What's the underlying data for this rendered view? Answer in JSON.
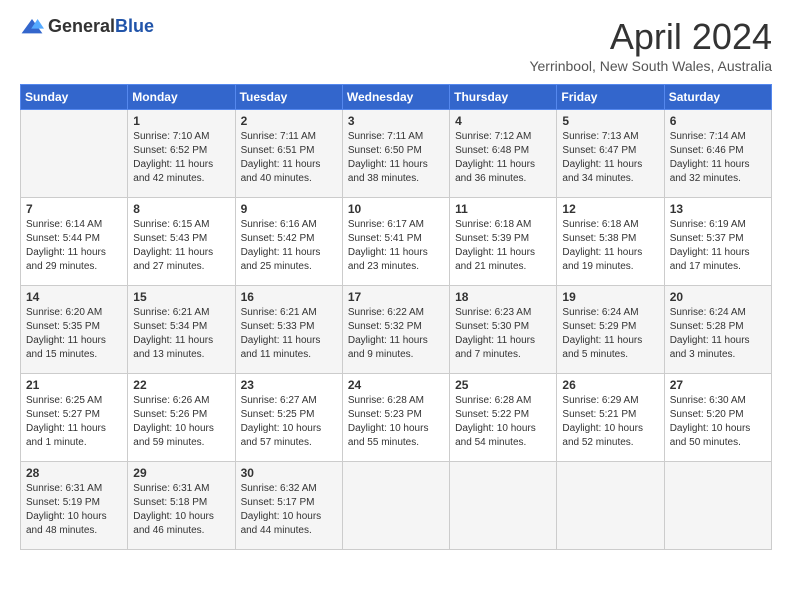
{
  "header": {
    "logo_general": "General",
    "logo_blue": "Blue",
    "month_title": "April 2024",
    "location": "Yerrinbool, New South Wales, Australia"
  },
  "days_of_week": [
    "Sunday",
    "Monday",
    "Tuesday",
    "Wednesday",
    "Thursday",
    "Friday",
    "Saturday"
  ],
  "weeks": [
    [
      {
        "day": "",
        "lines": []
      },
      {
        "day": "1",
        "lines": [
          "Sunrise: 7:10 AM",
          "Sunset: 6:52 PM",
          "Daylight: 11 hours",
          "and 42 minutes."
        ]
      },
      {
        "day": "2",
        "lines": [
          "Sunrise: 7:11 AM",
          "Sunset: 6:51 PM",
          "Daylight: 11 hours",
          "and 40 minutes."
        ]
      },
      {
        "day": "3",
        "lines": [
          "Sunrise: 7:11 AM",
          "Sunset: 6:50 PM",
          "Daylight: 11 hours",
          "and 38 minutes."
        ]
      },
      {
        "day": "4",
        "lines": [
          "Sunrise: 7:12 AM",
          "Sunset: 6:48 PM",
          "Daylight: 11 hours",
          "and 36 minutes."
        ]
      },
      {
        "day": "5",
        "lines": [
          "Sunrise: 7:13 AM",
          "Sunset: 6:47 PM",
          "Daylight: 11 hours",
          "and 34 minutes."
        ]
      },
      {
        "day": "6",
        "lines": [
          "Sunrise: 7:14 AM",
          "Sunset: 6:46 PM",
          "Daylight: 11 hours",
          "and 32 minutes."
        ]
      }
    ],
    [
      {
        "day": "7",
        "lines": [
          "Sunrise: 6:14 AM",
          "Sunset: 5:44 PM",
          "Daylight: 11 hours",
          "and 29 minutes."
        ]
      },
      {
        "day": "8",
        "lines": [
          "Sunrise: 6:15 AM",
          "Sunset: 5:43 PM",
          "Daylight: 11 hours",
          "and 27 minutes."
        ]
      },
      {
        "day": "9",
        "lines": [
          "Sunrise: 6:16 AM",
          "Sunset: 5:42 PM",
          "Daylight: 11 hours",
          "and 25 minutes."
        ]
      },
      {
        "day": "10",
        "lines": [
          "Sunrise: 6:17 AM",
          "Sunset: 5:41 PM",
          "Daylight: 11 hours",
          "and 23 minutes."
        ]
      },
      {
        "day": "11",
        "lines": [
          "Sunrise: 6:18 AM",
          "Sunset: 5:39 PM",
          "Daylight: 11 hours",
          "and 21 minutes."
        ]
      },
      {
        "day": "12",
        "lines": [
          "Sunrise: 6:18 AM",
          "Sunset: 5:38 PM",
          "Daylight: 11 hours",
          "and 19 minutes."
        ]
      },
      {
        "day": "13",
        "lines": [
          "Sunrise: 6:19 AM",
          "Sunset: 5:37 PM",
          "Daylight: 11 hours",
          "and 17 minutes."
        ]
      }
    ],
    [
      {
        "day": "14",
        "lines": [
          "Sunrise: 6:20 AM",
          "Sunset: 5:35 PM",
          "Daylight: 11 hours",
          "and 15 minutes."
        ]
      },
      {
        "day": "15",
        "lines": [
          "Sunrise: 6:21 AM",
          "Sunset: 5:34 PM",
          "Daylight: 11 hours",
          "and 13 minutes."
        ]
      },
      {
        "day": "16",
        "lines": [
          "Sunrise: 6:21 AM",
          "Sunset: 5:33 PM",
          "Daylight: 11 hours",
          "and 11 minutes."
        ]
      },
      {
        "day": "17",
        "lines": [
          "Sunrise: 6:22 AM",
          "Sunset: 5:32 PM",
          "Daylight: 11 hours",
          "and 9 minutes."
        ]
      },
      {
        "day": "18",
        "lines": [
          "Sunrise: 6:23 AM",
          "Sunset: 5:30 PM",
          "Daylight: 11 hours",
          "and 7 minutes."
        ]
      },
      {
        "day": "19",
        "lines": [
          "Sunrise: 6:24 AM",
          "Sunset: 5:29 PM",
          "Daylight: 11 hours",
          "and 5 minutes."
        ]
      },
      {
        "day": "20",
        "lines": [
          "Sunrise: 6:24 AM",
          "Sunset: 5:28 PM",
          "Daylight: 11 hours",
          "and 3 minutes."
        ]
      }
    ],
    [
      {
        "day": "21",
        "lines": [
          "Sunrise: 6:25 AM",
          "Sunset: 5:27 PM",
          "Daylight: 11 hours",
          "and 1 minute."
        ]
      },
      {
        "day": "22",
        "lines": [
          "Sunrise: 6:26 AM",
          "Sunset: 5:26 PM",
          "Daylight: 10 hours",
          "and 59 minutes."
        ]
      },
      {
        "day": "23",
        "lines": [
          "Sunrise: 6:27 AM",
          "Sunset: 5:25 PM",
          "Daylight: 10 hours",
          "and 57 minutes."
        ]
      },
      {
        "day": "24",
        "lines": [
          "Sunrise: 6:28 AM",
          "Sunset: 5:23 PM",
          "Daylight: 10 hours",
          "and 55 minutes."
        ]
      },
      {
        "day": "25",
        "lines": [
          "Sunrise: 6:28 AM",
          "Sunset: 5:22 PM",
          "Daylight: 10 hours",
          "and 54 minutes."
        ]
      },
      {
        "day": "26",
        "lines": [
          "Sunrise: 6:29 AM",
          "Sunset: 5:21 PM",
          "Daylight: 10 hours",
          "and 52 minutes."
        ]
      },
      {
        "day": "27",
        "lines": [
          "Sunrise: 6:30 AM",
          "Sunset: 5:20 PM",
          "Daylight: 10 hours",
          "and 50 minutes."
        ]
      }
    ],
    [
      {
        "day": "28",
        "lines": [
          "Sunrise: 6:31 AM",
          "Sunset: 5:19 PM",
          "Daylight: 10 hours",
          "and 48 minutes."
        ]
      },
      {
        "day": "29",
        "lines": [
          "Sunrise: 6:31 AM",
          "Sunset: 5:18 PM",
          "Daylight: 10 hours",
          "and 46 minutes."
        ]
      },
      {
        "day": "30",
        "lines": [
          "Sunrise: 6:32 AM",
          "Sunset: 5:17 PM",
          "Daylight: 10 hours",
          "and 44 minutes."
        ]
      },
      {
        "day": "",
        "lines": []
      },
      {
        "day": "",
        "lines": []
      },
      {
        "day": "",
        "lines": []
      },
      {
        "day": "",
        "lines": []
      }
    ]
  ]
}
